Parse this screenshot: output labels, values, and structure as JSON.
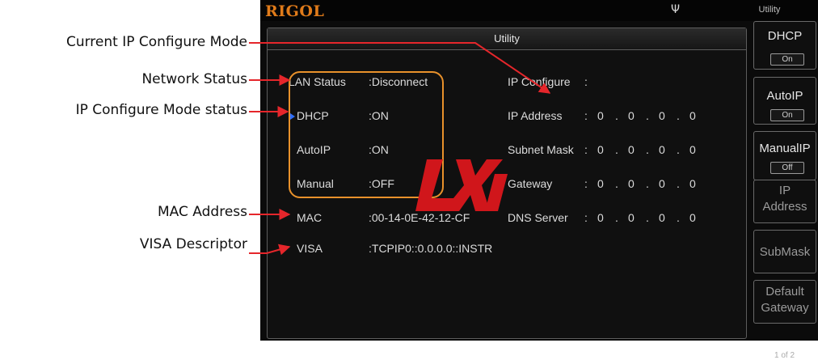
{
  "callouts": {
    "current_ip_mode": "Current IP Configure Mode",
    "network_status": "Network Status",
    "ip_mode_status": "IP Configure Mode status",
    "mac_address": "MAC Address",
    "visa_descriptor": "VISA Descriptor"
  },
  "device": {
    "brand": "RIGOL",
    "function_title": "Utility",
    "usb_icon": "usb-icon",
    "accent_color": "#e8912b",
    "lxi_color": "#d0161b"
  },
  "panel": {
    "title": "Utility",
    "lan_status": {
      "label": "LAN Status",
      "value": ":Disconnect"
    },
    "ip_modes": [
      {
        "label": "DHCP",
        "value": ":ON"
      },
      {
        "label": "AutoIP",
        "value": ":ON"
      },
      {
        "label": "Manual",
        "value": ":OFF"
      }
    ],
    "mac": {
      "label": "MAC",
      "value": ":00-14-0E-42-12-CF"
    },
    "visa": {
      "label": "VISA",
      "value": ":TCPIP0::0.0.0.0::INSTR"
    },
    "ip_configure": {
      "label": "IP Configure",
      "value": ":"
    },
    "network": [
      {
        "label": "IP Address",
        "octets": [
          "0",
          "0",
          "0",
          "0"
        ]
      },
      {
        "label": "Subnet Mask",
        "octets": [
          "0",
          "0",
          "0",
          "0"
        ]
      },
      {
        "label": "Gateway",
        "octets": [
          "0",
          "0",
          "0",
          "0"
        ]
      },
      {
        "label": "DNS Server",
        "octets": [
          "0",
          "0",
          "0",
          "0"
        ]
      }
    ],
    "separator": ":",
    "dot": "."
  },
  "softkeys": {
    "dhcp": {
      "label": "DHCP",
      "state": "On"
    },
    "autoip": {
      "label": "AutoIP",
      "state": "On"
    },
    "manualip": {
      "label": "ManualIP",
      "state": "Off"
    },
    "ip_address": {
      "line1": "IP",
      "line2": "Address"
    },
    "submask": {
      "label": "SubMask"
    },
    "default_gateway": {
      "line1": "Default",
      "line2": "Gateway"
    },
    "page": "1 of 2"
  }
}
